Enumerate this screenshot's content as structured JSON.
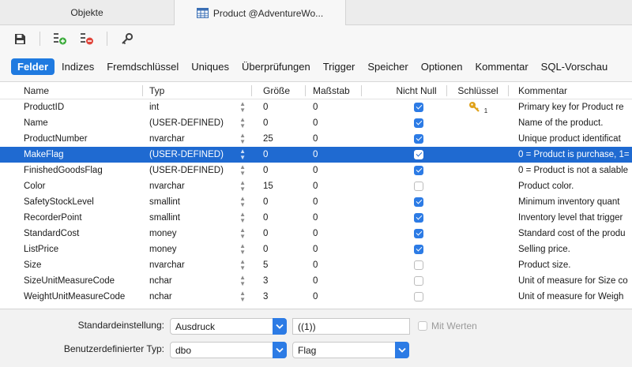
{
  "window_tabs": [
    {
      "label": "Objekte",
      "active": false
    },
    {
      "label": "Product @AdventureWo...",
      "active": true
    }
  ],
  "toolbar": {
    "buttons": [
      {
        "name": "save-icon"
      },
      {
        "name": "add-field-icon"
      },
      {
        "name": "delete-field-icon"
      },
      {
        "name": "key-icon"
      }
    ]
  },
  "section_tabs": [
    "Felder",
    "Indizes",
    "Fremdschlüssel",
    "Uniques",
    "Überprüfungen",
    "Trigger",
    "Speicher",
    "Optionen",
    "Kommentar",
    "SQL-Vorschau"
  ],
  "active_section": "Felder",
  "columns": {
    "name": "Name",
    "type": "Typ",
    "size": "Größe",
    "scale": "Maßstab",
    "not_null": "Nicht Null",
    "key": "Schlüssel",
    "comment": "Kommentar"
  },
  "rows": [
    {
      "name": "ProductID",
      "type": "int",
      "size": "0",
      "scale": "0",
      "not_null": true,
      "key": "1",
      "comment": "Primary key for Product re"
    },
    {
      "name": "Name",
      "type": "(USER-DEFINED)",
      "size": "0",
      "scale": "0",
      "not_null": true,
      "key": "",
      "comment": "Name of the product."
    },
    {
      "name": "ProductNumber",
      "type": "nvarchar",
      "size": "25",
      "scale": "0",
      "not_null": true,
      "key": "",
      "comment": "Unique product identificat"
    },
    {
      "name": "MakeFlag",
      "type": "(USER-DEFINED)",
      "size": "0",
      "scale": "0",
      "not_null": true,
      "key": "",
      "comment": "0 = Product is purchase, 1="
    },
    {
      "name": "FinishedGoodsFlag",
      "type": "(USER-DEFINED)",
      "size": "0",
      "scale": "0",
      "not_null": true,
      "key": "",
      "comment": "0 = Product is not a salable"
    },
    {
      "name": "Color",
      "type": "nvarchar",
      "size": "15",
      "scale": "0",
      "not_null": false,
      "key": "",
      "comment": "Product color."
    },
    {
      "name": "SafetyStockLevel",
      "type": "smallint",
      "size": "0",
      "scale": "0",
      "not_null": true,
      "key": "",
      "comment": "Minimum inventory quant"
    },
    {
      "name": "RecorderPoint",
      "type": "smallint",
      "size": "0",
      "scale": "0",
      "not_null": true,
      "key": "",
      "comment": "Inventory level that trigger"
    },
    {
      "name": "StandardCost",
      "type": "money",
      "size": "0",
      "scale": "0",
      "not_null": true,
      "key": "",
      "comment": "Standard cost of the produ"
    },
    {
      "name": "ListPrice",
      "type": "money",
      "size": "0",
      "scale": "0",
      "not_null": true,
      "key": "",
      "comment": "Selling price."
    },
    {
      "name": "Size",
      "type": "nvarchar",
      "size": "5",
      "scale": "0",
      "not_null": false,
      "key": "",
      "comment": "Product size."
    },
    {
      "name": "SizeUnitMeasureCode",
      "type": "nchar",
      "size": "3",
      "scale": "0",
      "not_null": false,
      "key": "",
      "comment": "Unit of measure for Size co"
    },
    {
      "name": "WeightUnitMeasureCode",
      "type": "nchar",
      "size": "3",
      "scale": "0",
      "not_null": false,
      "key": "",
      "comment": "Unit of measure for Weigh"
    }
  ],
  "selected_row": "MakeFlag",
  "bottom": {
    "default_label": "Standardeinstellung:",
    "default_select": "Ausdruck",
    "default_value": "((1))",
    "with_values_label": "Mit Werten",
    "userdef_label": "Benutzerdefinierter Typ:",
    "userdef_schema": "dbo",
    "userdef_type": "Flag"
  },
  "colors": {
    "accent": "#1f7ae0",
    "selection": "#1f6ad1",
    "key_gold": "#e0a21a"
  }
}
